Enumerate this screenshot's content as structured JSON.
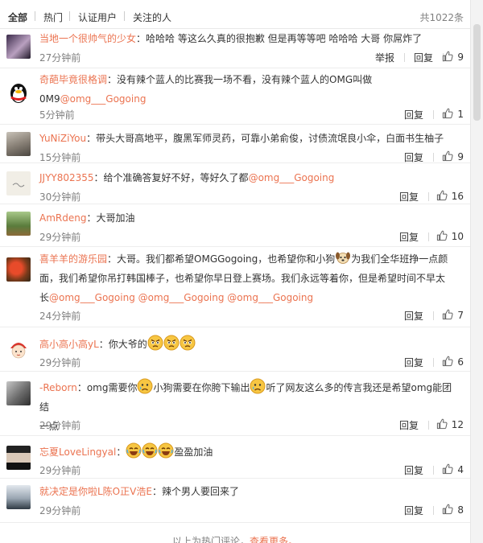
{
  "tabs": {
    "all": "全部",
    "hot": "热门",
    "verified": "认证用户",
    "following": "关注的人",
    "total": "共1022条"
  },
  "actions": {
    "report": "举报",
    "reply": "回复"
  },
  "comments": [
    {
      "user": "当地一个很帅气的少女",
      "text": "：哈哈哈 等这么久真的很抱歉 但是再等等吧 哈哈哈 大哥 你屌炸了",
      "time": "27分钟前",
      "likes": "9"
    },
    {
      "user": "奇葩毕竟很格调",
      "text1": "：没有辣个蓝人的比赛我一场不看，没有辣个蓝人的OMG叫做",
      "text2": "0M9",
      "mention": "@omg___Gogoing",
      "time": "5分钟前",
      "likes": "1"
    },
    {
      "user": "YuNiZiYou",
      "text": "：带头大哥高地平，腹黑军师灵药，可靠小弟俞俊，讨债流氓良小伞，白面书生柚子",
      "time": "15分钟前",
      "likes": "9"
    },
    {
      "user": "JJYY802355",
      "text": "：给个准确答复好不好，等好久了都",
      "mention": "@omg___Gogoing",
      "time": "30分钟前",
      "likes": "16"
    },
    {
      "user": "AmRdeng",
      "text": "：大哥加油",
      "time": "29分钟前",
      "likes": "10"
    },
    {
      "user": "喜羊羊的游乐园",
      "text1": "：大哥。我们都希望OMGGogoing，也希望你和小狗",
      "text1b": "为我们全华班挣一点颜",
      "text2": "面，我们希望你吊打韩国棒子，也希望你早日登上赛场。我们永远等着你，但是希望时间不早太",
      "text3": "长",
      "mentions": [
        "@omg___Gogoing",
        "@omg___Gogoing",
        "@omg___Gogoing"
      ],
      "time": "24分钟前",
      "likes": "7"
    },
    {
      "user": "高小高小高yL",
      "text": "：你大爷的",
      "time": "29分钟前",
      "likes": "6"
    },
    {
      "user": "-Reborn",
      "text1": "：omg需要你",
      "text1b": "小狗需要在你胯下输出",
      "text1c": "听了网友这么多的传言我还是希望omg能团结",
      "text2": "一点",
      "time": "29分钟前",
      "likes": "12"
    },
    {
      "user": "忘夏LoveLingyal",
      "text": "：",
      "text_after": "盈盈加油",
      "time": "29分钟前",
      "likes": "4"
    },
    {
      "user": "就决定是你啦L陈O正V浩E",
      "text": "：辣个男人要回来了",
      "time": "29分钟前",
      "likes": "8"
    }
  ],
  "footer": {
    "text": "以上为热门评论，",
    "more": "查看更多。"
  },
  "colors": {
    "link": "#eb7350",
    "time": "#808080"
  },
  "icons": [
    "thumbs-up-icon",
    "dog-face-emoji",
    "angry-face-emoji",
    "sad-face-emoji",
    "laughing-tears-emoji"
  ]
}
